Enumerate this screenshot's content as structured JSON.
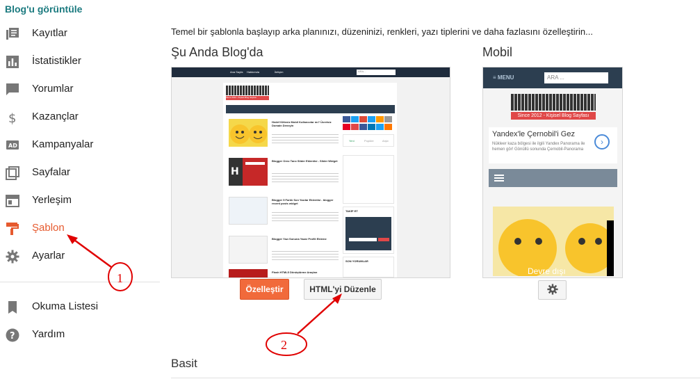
{
  "sidebar": {
    "blog_link": "Blog'u görüntüle",
    "items": [
      {
        "label": "Kayıtlar",
        "icon": "posts-icon"
      },
      {
        "label": "İstatistikler",
        "icon": "stats-icon"
      },
      {
        "label": "Yorumlar",
        "icon": "comments-icon"
      },
      {
        "label": "Kazançlar",
        "icon": "dollar-icon"
      },
      {
        "label": "Kampanyalar",
        "icon": "ad-icon"
      },
      {
        "label": "Sayfalar",
        "icon": "pages-icon"
      },
      {
        "label": "Yerleşim",
        "icon": "layout-icon"
      },
      {
        "label": "Şablon",
        "icon": "paint-roller-icon",
        "active": true
      },
      {
        "label": "Ayarlar",
        "icon": "gear-icon"
      }
    ],
    "secondary": [
      {
        "label": "Okuma Listesi",
        "icon": "bookmark-icon"
      },
      {
        "label": "Yardım",
        "icon": "help-icon"
      }
    ]
  },
  "main": {
    "intro": "Temel bir şablonla başlayıp arka planınızı, düzeninizi, renkleri, yazı tiplerini ve daha fazlasını özelleştirin...",
    "current_title": "Şu Anda Blog'da",
    "mobile_title": "Mobil",
    "customize_label": "Özelleştir",
    "edit_html_label": "HTML'yi Düzenle",
    "basic_title": "Basit"
  },
  "preview_desktop": {
    "search_placeholder": "ARA...",
    "logo_tagline": "Since 2012 - Kişisel Blog Sayfası",
    "posts": [
      {
        "title": "Hedef Kitleniz Mobil Kullanıcılar mı? Ücretsiz Domain Deneyin"
      },
      {
        "title": "Blogger Oreo Tarzı Slider Eklentisi - Slider Widget"
      },
      {
        "title": "Blogger 5 Farklı Son Yazılar Eklentisi - blogger recent posts widget"
      },
      {
        "title": "Blogger Yazı Sonuna Yazar Profili Ekleme"
      },
      {
        "title": "Flash HTML5 Dönüştürme Araçları"
      }
    ],
    "tab_labels": [
      "Yeni",
      "Popüler",
      "Arşiv"
    ],
    "takip_label": "TAKİP ET",
    "comments_label": "SON YORUMLAR"
  },
  "preview_mobile": {
    "menu_label": "≡ MENU",
    "search_placeholder": "ARA ...",
    "tagline": "Since 2012 - Kişisel Blog Sayfası",
    "ad_title": "Yandex'le Çernobil'i Gez",
    "ad_text": "Nükleer kaza bölgesi ile ilgili Yandex Panorama ile hemen gör! Gönüllü sonunda Çernobil-Panorama",
    "feature_text": "Devre dışı"
  },
  "annotations": [
    {
      "number": "1"
    },
    {
      "number": "2"
    }
  ],
  "colors": {
    "accent": "#e65a2e",
    "link": "#1b7a7f",
    "annotation": "#e00000"
  }
}
